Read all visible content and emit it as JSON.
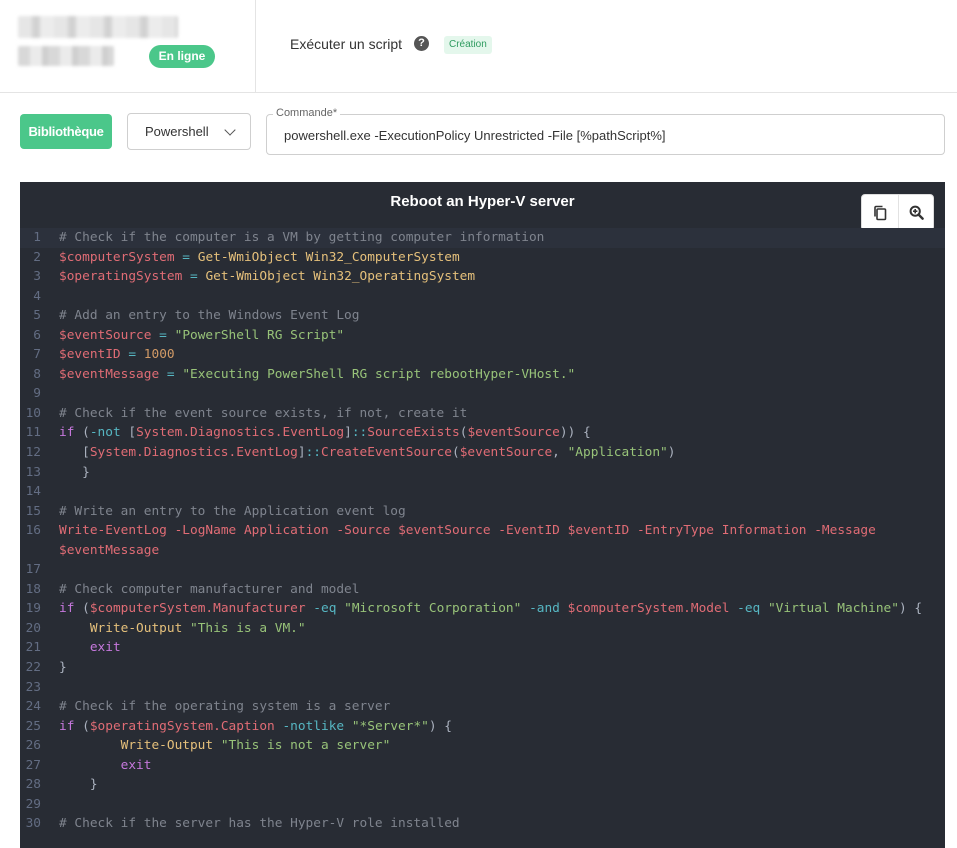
{
  "header": {
    "status_badge": "En ligne",
    "page_title": "Exécuter un script",
    "help_icon": "question-circle-icon",
    "creation_badge": "Création"
  },
  "toolbar": {
    "library_button": "Bibliothèque",
    "language_select": "Powershell",
    "command_label": "Commande*",
    "command_value": "powershell.exe -ExecutionPolicy Unrestricted -File [%pathScript%]"
  },
  "script": {
    "title": "Reboot an Hyper-V server",
    "copy_icon": "copy-icon",
    "zoom_icon": "zoom-in-icon",
    "lines": [
      {
        "n": "1",
        "tokens": [
          [
            "c",
            "# Check if the computer is a VM by getting computer information"
          ]
        ]
      },
      {
        "n": "2",
        "tokens": [
          [
            "v",
            "$computerSystem"
          ],
          [
            "t",
            " "
          ],
          [
            "o",
            "="
          ],
          [
            "t",
            " "
          ],
          [
            "f",
            "Get-WmiObject Win32_ComputerSystem"
          ]
        ]
      },
      {
        "n": "3",
        "tokens": [
          [
            "v",
            "$operatingSystem"
          ],
          [
            "t",
            " "
          ],
          [
            "o",
            "="
          ],
          [
            "t",
            " "
          ],
          [
            "f",
            "Get-WmiObject Win32_OperatingSystem"
          ]
        ]
      },
      {
        "n": "4",
        "tokens": []
      },
      {
        "n": "5",
        "tokens": [
          [
            "c",
            "# Add an entry to the Windows Event Log"
          ]
        ]
      },
      {
        "n": "6",
        "tokens": [
          [
            "v",
            "$eventSource"
          ],
          [
            "t",
            " "
          ],
          [
            "o",
            "="
          ],
          [
            "t",
            " "
          ],
          [
            "s",
            "\"PowerShell RG Script\""
          ]
        ]
      },
      {
        "n": "7",
        "tokens": [
          [
            "v",
            "$eventID"
          ],
          [
            "t",
            " "
          ],
          [
            "o",
            "="
          ],
          [
            "t",
            " "
          ],
          [
            "n",
            "1000"
          ]
        ]
      },
      {
        "n": "8",
        "tokens": [
          [
            "v",
            "$eventMessage"
          ],
          [
            "t",
            " "
          ],
          [
            "o",
            "="
          ],
          [
            "t",
            " "
          ],
          [
            "s",
            "\"Executing PowerShell RG script rebootHyper-VHost.\""
          ]
        ]
      },
      {
        "n": "9",
        "tokens": []
      },
      {
        "n": "10",
        "tokens": [
          [
            "c",
            "# Check if the event source exists, if not, create it"
          ]
        ]
      },
      {
        "n": "11",
        "tokens": [
          [
            "k",
            "if"
          ],
          [
            "t",
            " ("
          ],
          [
            "o",
            "-not"
          ],
          [
            "t",
            " ["
          ],
          [
            "v",
            "System.Diagnostics.EventLog"
          ],
          [
            "t",
            "]"
          ],
          [
            "o",
            "::"
          ],
          [
            "v",
            "SourceExists"
          ],
          [
            "t",
            "("
          ],
          [
            "v",
            "$eventSource"
          ],
          [
            "t",
            ")) {"
          ]
        ]
      },
      {
        "n": "12",
        "tokens": [
          [
            "t",
            "   ["
          ],
          [
            "v",
            "System.Diagnostics.EventLog"
          ],
          [
            "t",
            "]"
          ],
          [
            "o",
            "::"
          ],
          [
            "v",
            "CreateEventSource"
          ],
          [
            "t",
            "("
          ],
          [
            "v",
            "$eventSource"
          ],
          [
            "t",
            ", "
          ],
          [
            "s",
            "\"Application\""
          ],
          [
            "t",
            ")"
          ]
        ]
      },
      {
        "n": "13",
        "tokens": [
          [
            "t",
            "   }"
          ]
        ]
      },
      {
        "n": "14",
        "tokens": []
      },
      {
        "n": "15",
        "tokens": [
          [
            "c",
            "# Write an entry to the Application event log"
          ]
        ]
      },
      {
        "n": "16",
        "tokens": [
          [
            "v",
            "Write-EventLog"
          ],
          [
            "t",
            " "
          ],
          [
            "v",
            "-LogName"
          ],
          [
            "t",
            " "
          ],
          [
            "v",
            "Application"
          ],
          [
            "t",
            " "
          ],
          [
            "v",
            "-Source"
          ],
          [
            "t",
            " "
          ],
          [
            "v",
            "$eventSource"
          ],
          [
            "t",
            " "
          ],
          [
            "v",
            "-EventID"
          ],
          [
            "t",
            " "
          ],
          [
            "v",
            "$eventID"
          ],
          [
            "t",
            " "
          ],
          [
            "v",
            "-EntryType"
          ],
          [
            "t",
            " "
          ],
          [
            "v",
            "Information"
          ],
          [
            "t",
            " "
          ],
          [
            "v",
            "-Message"
          ]
        ]
      },
      {
        "n": "",
        "tokens": [
          [
            "v",
            "$eventMessage"
          ]
        ]
      },
      {
        "n": "17",
        "tokens": []
      },
      {
        "n": "18",
        "tokens": [
          [
            "c",
            "# Check computer manufacturer and model"
          ]
        ]
      },
      {
        "n": "19",
        "tokens": [
          [
            "k",
            "if"
          ],
          [
            "t",
            " ("
          ],
          [
            "v",
            "$computerSystem.Manufacturer"
          ],
          [
            "t",
            " "
          ],
          [
            "o",
            "-eq"
          ],
          [
            "t",
            " "
          ],
          [
            "s",
            "\"Microsoft Corporation\""
          ],
          [
            "t",
            " "
          ],
          [
            "o",
            "-and"
          ],
          [
            "t",
            " "
          ],
          [
            "v",
            "$computerSystem.Model"
          ],
          [
            "t",
            " "
          ],
          [
            "o",
            "-eq"
          ],
          [
            "t",
            " "
          ],
          [
            "s",
            "\"Virtual Machine\""
          ],
          [
            "t",
            ") {"
          ]
        ]
      },
      {
        "n": "20",
        "tokens": [
          [
            "t",
            "    "
          ],
          [
            "f",
            "Write-Output"
          ],
          [
            "t",
            " "
          ],
          [
            "s",
            "\"This is a VM.\""
          ]
        ]
      },
      {
        "n": "21",
        "tokens": [
          [
            "t",
            "    "
          ],
          [
            "k",
            "exit"
          ]
        ]
      },
      {
        "n": "22",
        "tokens": [
          [
            "t",
            "}"
          ]
        ]
      },
      {
        "n": "23",
        "tokens": []
      },
      {
        "n": "24",
        "tokens": [
          [
            "c",
            "# Check if the operating system is a server"
          ]
        ]
      },
      {
        "n": "25",
        "tokens": [
          [
            "k",
            "if"
          ],
          [
            "t",
            " ("
          ],
          [
            "v",
            "$operatingSystem.Caption"
          ],
          [
            "t",
            " "
          ],
          [
            "o",
            "-notlike"
          ],
          [
            "t",
            " "
          ],
          [
            "s",
            "\"*Server*\""
          ],
          [
            "t",
            ") {"
          ]
        ]
      },
      {
        "n": "26",
        "tokens": [
          [
            "t",
            "        "
          ],
          [
            "f",
            "Write-Output"
          ],
          [
            "t",
            " "
          ],
          [
            "s",
            "\"This is not a server\""
          ]
        ]
      },
      {
        "n": "27",
        "tokens": [
          [
            "t",
            "        "
          ],
          [
            "k",
            "exit"
          ]
        ]
      },
      {
        "n": "28",
        "tokens": [
          [
            "t",
            "    }"
          ]
        ]
      },
      {
        "n": "29",
        "tokens": []
      },
      {
        "n": "30",
        "tokens": [
          [
            "c",
            "# Check if the server has the Hyper-V role installed"
          ]
        ]
      }
    ]
  }
}
